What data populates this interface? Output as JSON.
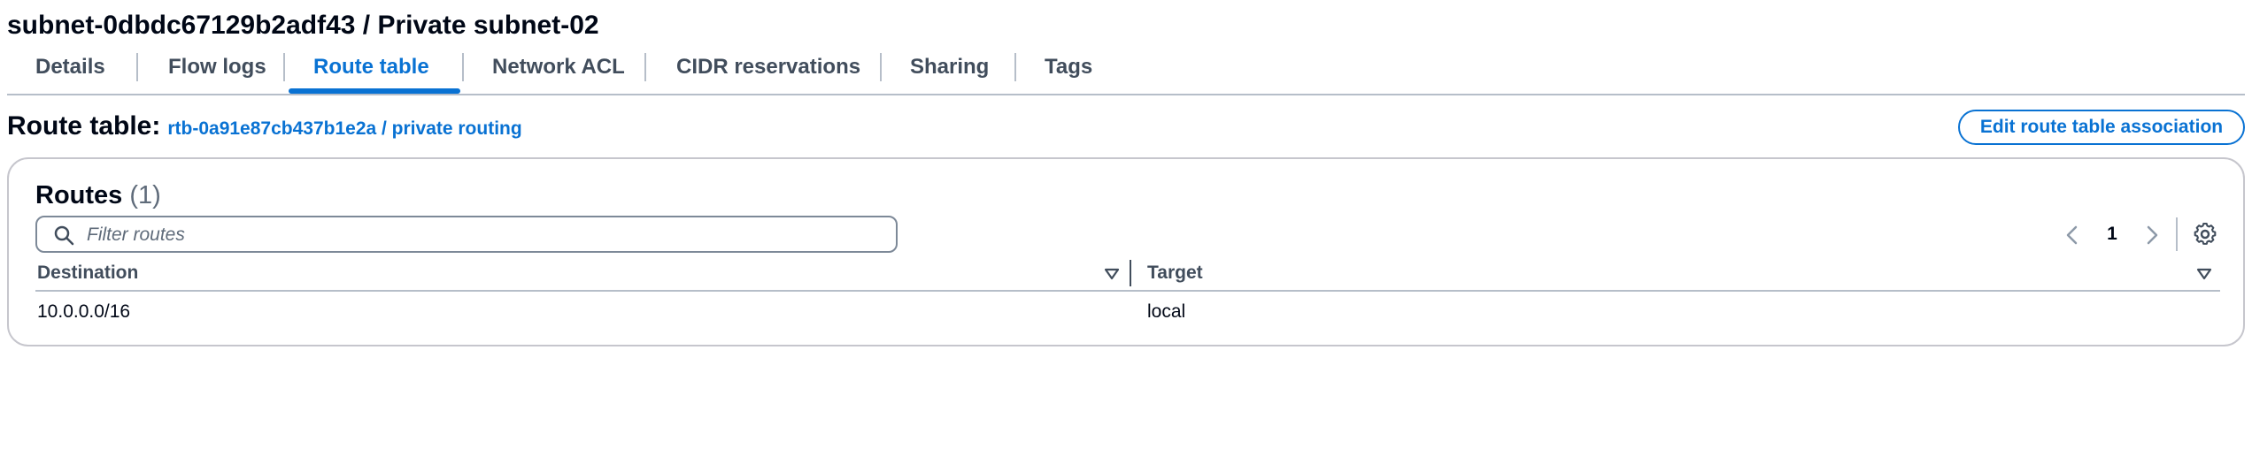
{
  "page_title": "subnet-0dbdc67129b2adf43 / Private subnet-02",
  "tabs": [
    {
      "label": "Details",
      "active": false
    },
    {
      "label": "Flow logs",
      "active": false
    },
    {
      "label": "Route table",
      "active": true
    },
    {
      "label": "Network ACL",
      "active": false
    },
    {
      "label": "CIDR reservations",
      "active": false
    },
    {
      "label": "Sharing",
      "active": false
    },
    {
      "label": "Tags",
      "active": false
    }
  ],
  "route_table": {
    "label": "Route table:",
    "link_text": "rtb-0a91e87cb437b1e2a / private routing",
    "edit_button_label": "Edit route table association"
  },
  "routes": {
    "title": "Routes",
    "count": "(1)",
    "filter_placeholder": "Filter routes",
    "filter_value": "",
    "current_page": "1",
    "columns": [
      "Destination",
      "Target"
    ],
    "rows": [
      {
        "destination": "10.0.0.0/16",
        "target": "local"
      }
    ]
  },
  "colors": {
    "accent": "#0972d3",
    "text": "#000716",
    "muted": "#5f6b7a",
    "border": "#b6bec9"
  },
  "icons": {
    "search": "search-icon",
    "prev": "chevron-left-icon",
    "next": "chevron-right-icon",
    "settings": "gear-icon",
    "sort": "sort-caret-down-icon"
  }
}
